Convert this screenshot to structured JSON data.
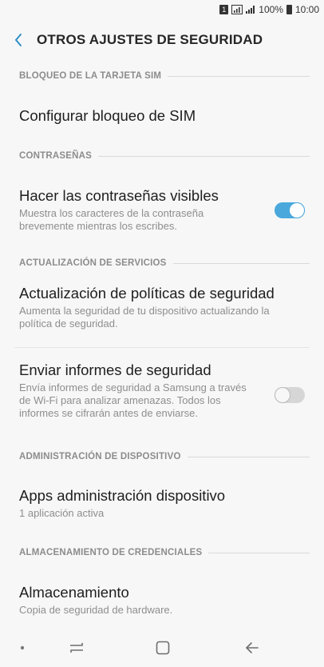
{
  "status_bar": {
    "sim_badge": "1",
    "battery": "100%",
    "time": "10:00"
  },
  "header": {
    "title": "OTROS AJUSTES DE SEGURIDAD"
  },
  "sections": {
    "sim": {
      "header": "BLOQUEO DE LA TARJETA SIM",
      "items": [
        {
          "title": "Configurar bloqueo de SIM"
        }
      ]
    },
    "passwords": {
      "header": "CONTRASEÑAS",
      "items": [
        {
          "title": "Hacer las contraseñas visibles",
          "subtitle": "Muestra los caracteres de la contraseña brevemente mientras los escribes.",
          "toggle": "on"
        }
      ]
    },
    "updates": {
      "header": "ACTUALIZACIÓN DE SERVICIOS",
      "items": [
        {
          "title": "Actualización de políticas de seguridad",
          "subtitle": "Aumenta la seguridad de tu dispositivo actualizando la política de seguridad."
        },
        {
          "title": "Enviar informes de seguridad",
          "subtitle": "Envía informes de seguridad a Samsung a través de Wi-Fi para analizar amenazas. Todos los informes se cifrarán antes de enviarse.",
          "toggle": "off"
        }
      ]
    },
    "device_admin": {
      "header": "ADMINISTRACIÓN DE DISPOSITIVO",
      "items": [
        {
          "title": "Apps administración dispositivo",
          "subtitle": "1 aplicación activa"
        }
      ]
    },
    "credentials": {
      "header": "ALMACENAMIENTO DE CREDENCIALES",
      "items": [
        {
          "title": "Almacenamiento",
          "subtitle": "Copia de seguridad de hardware."
        }
      ]
    }
  },
  "colors": {
    "accent": "#4aa8dc",
    "background": "#f7f7f7",
    "section_header": "#8c8c8c"
  },
  "icons": {
    "back": "chevron-left-icon",
    "nav_dot": "dot-icon",
    "nav_recents": "recents-icon",
    "nav_home": "home-icon",
    "nav_back": "back-arrow-icon"
  }
}
